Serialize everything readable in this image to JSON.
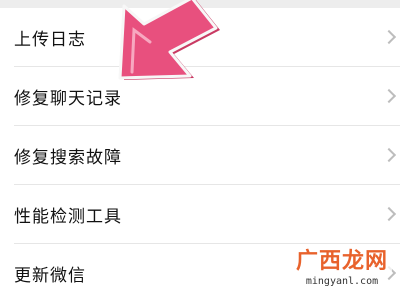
{
  "menu": {
    "items": [
      {
        "label": "上传日志"
      },
      {
        "label": "修复聊天记录"
      },
      {
        "label": "修复搜索故障"
      },
      {
        "label": "性能检测工具"
      },
      {
        "label": "更新微信"
      }
    ]
  },
  "icons": {
    "row_chevron": "chevron-right-icon",
    "pointer": "pink-arrow-icon"
  },
  "watermark": {
    "chinese": "广西龙网",
    "url": "mingyanl.com"
  },
  "colors": {
    "arrow": "#e8507e",
    "watermark": "#e8622c"
  }
}
